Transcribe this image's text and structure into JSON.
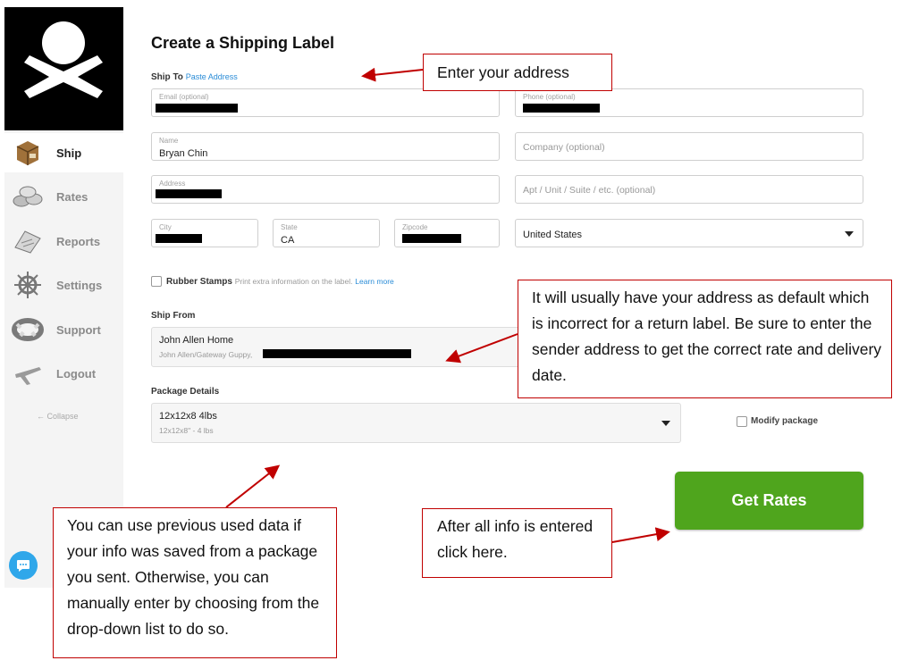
{
  "sidebar": {
    "items": [
      {
        "label": "Ship",
        "icon": "package-box-icon",
        "active": true
      },
      {
        "label": "Rates",
        "icon": "coins-icon",
        "active": false
      },
      {
        "label": "Reports",
        "icon": "clipboard-icon",
        "active": false
      },
      {
        "label": "Settings",
        "icon": "ship-wheel-icon",
        "active": false
      },
      {
        "label": "Support",
        "icon": "life-ring-icon",
        "active": false
      },
      {
        "label": "Logout",
        "icon": "airplane-icon",
        "active": false
      }
    ],
    "collapse_label": "← Collapse"
  },
  "form": {
    "title": "Create a Shipping Label",
    "ship_to": {
      "label": "Ship To",
      "paste_link": "Paste Address",
      "email_label": "Email (optional)",
      "phone_label": "Phone (optional)",
      "name_label": "Name",
      "name_value": "Bryan Chin",
      "company_placeholder": "Company (optional)",
      "address_label": "Address",
      "apt_placeholder": "Apt / Unit / Suite / etc. (optional)",
      "city_label": "City",
      "state_label": "State",
      "state_value": "CA",
      "zip_label": "Zipcode",
      "country_value": "United States"
    },
    "rubber_stamps": {
      "label": "Rubber Stamps",
      "hint": "Print extra information on the label.",
      "link": "Learn more"
    },
    "ship_from": {
      "label": "Ship From",
      "name": "John Allen Home",
      "subline": "John Allen/Gateway Guppy,"
    },
    "package": {
      "label": "Package Details",
      "name": "12x12x8 4lbs",
      "subline": "12x12x8\" - 4 lbs",
      "modify_label": "Modify package"
    },
    "get_rates_label": "Get Rates"
  },
  "callouts": {
    "address": "Enter your address",
    "ship_from": "It will usually have your address as default which is incorrect for a return label. Be sure to enter the sender address to get the correct rate and delivery date.",
    "package": "You can use previous used data if your info was saved from a package you sent. Otherwise, you can manually enter by choosing from the drop-down list to do so.",
    "get_rates": "After all info is entered click here."
  },
  "colors": {
    "accent_green": "#4fa51d",
    "link_blue": "#2a8cd7",
    "callout_red": "#c00000"
  }
}
